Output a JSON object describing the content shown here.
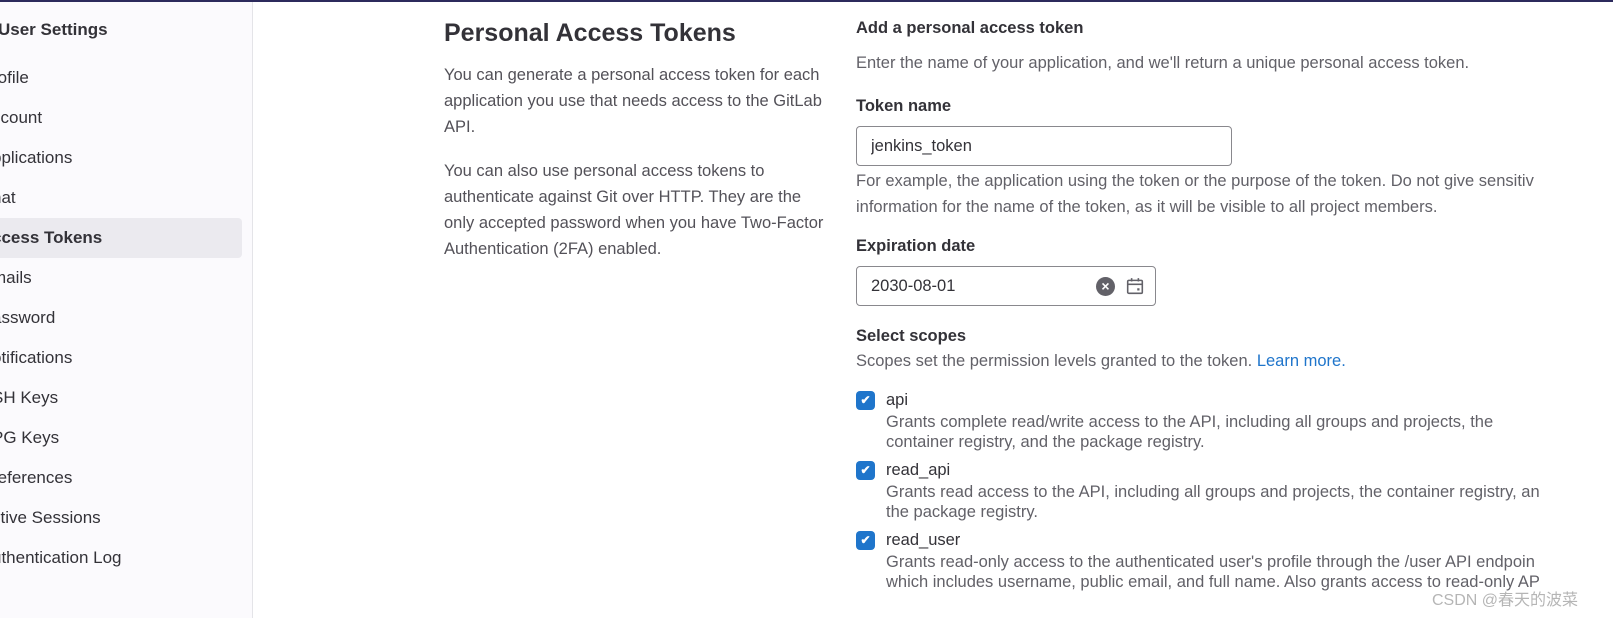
{
  "sidebar": {
    "title": "User Settings",
    "items": [
      {
        "label": "rofile",
        "active": false
      },
      {
        "label": "ccount",
        "active": false
      },
      {
        "label": "pplications",
        "active": false
      },
      {
        "label": "hat",
        "active": false
      },
      {
        "label": "ccess Tokens",
        "active": true
      },
      {
        "label": "mails",
        "active": false
      },
      {
        "label": "assword",
        "active": false
      },
      {
        "label": "otifications",
        "active": false
      },
      {
        "label": "SH Keys",
        "active": false
      },
      {
        "label": "PG Keys",
        "active": false
      },
      {
        "label": "references",
        "active": false
      },
      {
        "label": "ctive Sessions",
        "active": false
      },
      {
        "label": "uthentication Log",
        "active": false
      }
    ]
  },
  "intro": {
    "title": "Personal Access Tokens",
    "paragraphs": [
      "You can generate a personal access token for each application you use that needs access to the GitLab API.",
      "You can also use personal access tokens to authenticate against Git over HTTP. They are the only accepted password when you have Two-Factor Authentication (2FA) enabled."
    ]
  },
  "form": {
    "heading": "Add a personal access token",
    "subheading": "Enter the name of your application, and we'll return a unique personal access token.",
    "token_name": {
      "label": "Token name",
      "value": "jenkins_token",
      "help_line1": "For example, the application using the token or the purpose of the token. Do not give sensitiv",
      "help_line2": "information for the name of the token, as it will be visible to all project members."
    },
    "expiration": {
      "label": "Expiration date",
      "value": "2030-08-01",
      "clear_icon": "clear-circle-icon",
      "calendar_icon": "calendar-icon"
    },
    "scopes": {
      "label": "Select scopes",
      "help": "Scopes set the permission levels granted to the token.",
      "learn_more": "Learn more.",
      "items": [
        {
          "name": "api",
          "checked": true,
          "desc1": "Grants complete read/write access to the API, including all groups and projects, the",
          "desc2": "container registry, and the package registry."
        },
        {
          "name": "read_api",
          "checked": true,
          "desc1": "Grants read access to the API, including all groups and projects, the container registry, an",
          "desc2": "the package registry."
        },
        {
          "name": "read_user",
          "checked": true,
          "desc1": "Grants read-only access to the authenticated user's profile through the /user API endpoin",
          "desc2": "which includes username, public email, and full name. Also grants access to read-only AP"
        }
      ]
    }
  },
  "watermark": "CSDN @春天的波菜",
  "colors": {
    "accent": "#1f75cb",
    "topbar": "#2c2a5c",
    "active_nav": "#ebeaef"
  }
}
